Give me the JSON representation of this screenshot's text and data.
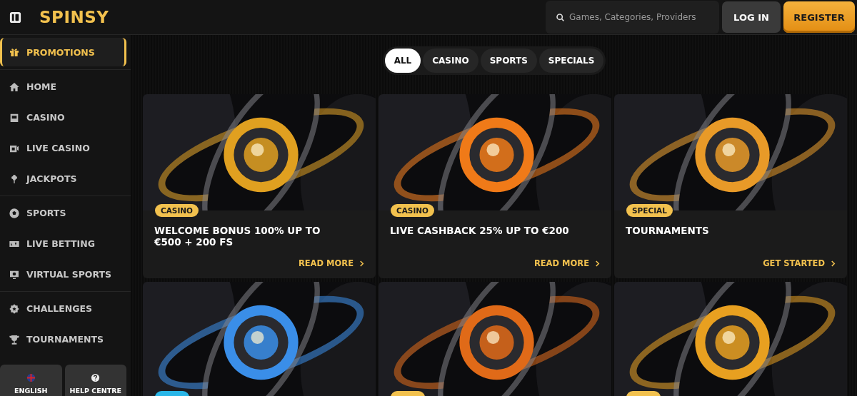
{
  "header": {
    "logo": "SPINSY",
    "search": {
      "placeholder": "Games, Categories, Providers"
    },
    "buttons": [
      {
        "label": "LOG IN",
        "kind": "secondary"
      },
      {
        "label": "REGISTER",
        "kind": "primary"
      }
    ]
  },
  "sidebar": {
    "groups": [
      [
        {
          "label": "PROMOTIONS",
          "selected": true
        }
      ],
      [
        {
          "label": "HOME",
          "selected": false
        },
        {
          "label": "CASINO",
          "selected": false
        },
        {
          "label": "LIVE CASINO",
          "selected": false
        },
        {
          "label": "JACKPOTS",
          "selected": false
        }
      ],
      [
        {
          "label": "SPORTS",
          "selected": false
        },
        {
          "label": "LIVE BETTING",
          "selected": false
        },
        {
          "label": "VIRTUAL SPORTS",
          "selected": false
        }
      ],
      [
        {
          "label": "CHALLENGES",
          "selected": false
        },
        {
          "label": "TOURNAMENTS",
          "selected": false
        }
      ]
    ],
    "footer_buttons": [
      {
        "label": "ENGLISH",
        "kind": "language"
      },
      {
        "label": "HELP CENTRE",
        "kind": "help"
      }
    ]
  },
  "filter_tabs": [
    {
      "label": "ALL",
      "selected": true
    },
    {
      "label": "CASINO",
      "selected": false
    },
    {
      "label": "SPORTS",
      "selected": false
    },
    {
      "label": "SPECIALS",
      "selected": false
    }
  ],
  "promotions": [
    {
      "badge": "CASINO",
      "title": "WELCOME BONUS 100% UP TO €500 + 200 FS",
      "action": "READ MORE",
      "color": "#e0a020"
    },
    {
      "badge": "CASINO",
      "title": "LIVE CASHBACK 25% UP TO €200",
      "action": "READ MORE",
      "color": "#f07a18"
    },
    {
      "badge": "SPECIAL",
      "title": "TOURNAMENTS",
      "action": "GET STARTED",
      "color": "#e89a28"
    },
    {
      "color": "#3a8ee8",
      "tag": {
        "color": "#29b6e8"
      }
    },
    {
      "color": "#e06a18",
      "tag": {
        "color": "#f2c14e"
      }
    },
    {
      "color": "#e8a020",
      "tag": {
        "color": "#f2c14e"
      }
    }
  ]
}
